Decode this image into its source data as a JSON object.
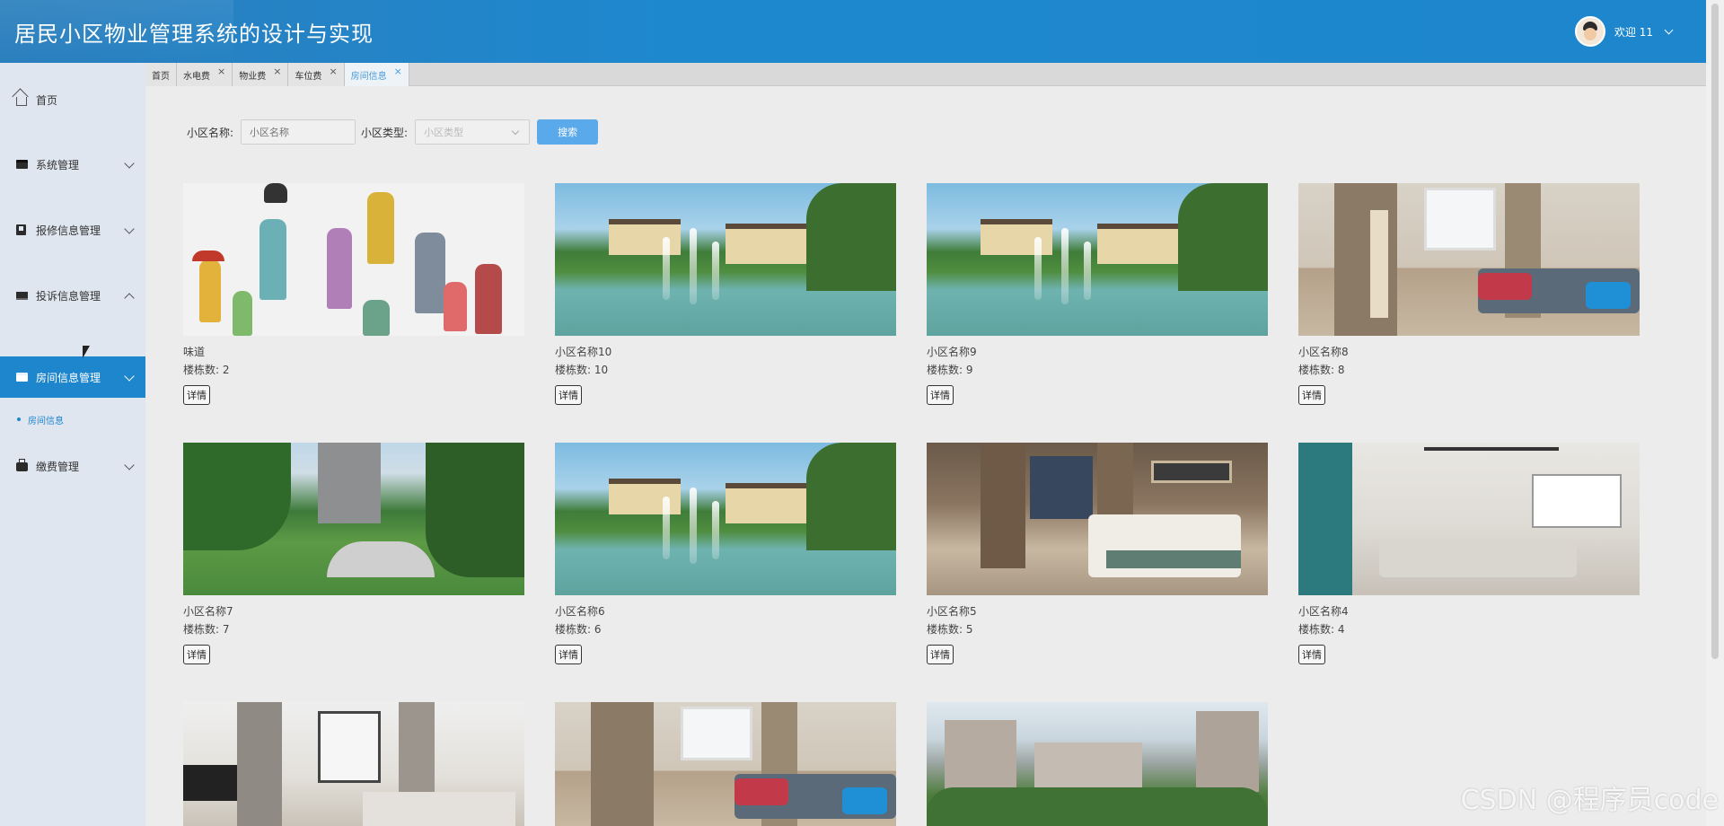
{
  "header": {
    "title": "居民小区物业管理系统的设计与实现",
    "welcome": "欢迎 11"
  },
  "sidebar": {
    "items": [
      {
        "label": "首页",
        "icon": "home-icon"
      },
      {
        "label": "系统管理",
        "icon": "box-icon"
      },
      {
        "label": "报修信息管理",
        "icon": "book-icon"
      },
      {
        "label": "投诉信息管理",
        "icon": "monitor-icon"
      },
      {
        "label": "房间信息管理",
        "icon": "box-icon"
      },
      {
        "label": "缴费管理",
        "icon": "bag-icon"
      }
    ],
    "sub_item": "房间信息"
  },
  "tabs": [
    {
      "label": "首页",
      "closable": false
    },
    {
      "label": "水电费",
      "closable": true
    },
    {
      "label": "物业费",
      "closable": true
    },
    {
      "label": "车位费",
      "closable": true
    },
    {
      "label": "房间信息",
      "closable": true
    }
  ],
  "search": {
    "name_label": "小区名称:",
    "name_placeholder": "小区名称",
    "type_label": "小区类型:",
    "type_placeholder": "小区类型",
    "button": "搜索"
  },
  "cards": [
    {
      "name": "味道",
      "count_label": "楼栋数:",
      "count": "2",
      "detail": "详情"
    },
    {
      "name": "小区名称10",
      "count_label": "楼栋数:",
      "count": "10",
      "detail": "详情"
    },
    {
      "name": "小区名称9",
      "count_label": "楼栋数:",
      "count": "9",
      "detail": "详情"
    },
    {
      "name": "小区名称8",
      "count_label": "楼栋数:",
      "count": "8",
      "detail": "详情"
    },
    {
      "name": "小区名称7",
      "count_label": "楼栋数:",
      "count": "7",
      "detail": "详情"
    },
    {
      "name": "小区名称6",
      "count_label": "楼栋数:",
      "count": "6",
      "detail": "详情"
    },
    {
      "name": "小区名称5",
      "count_label": "楼栋数:",
      "count": "5",
      "detail": "详情"
    },
    {
      "name": "小区名称4",
      "count_label": "楼栋数:",
      "count": "4",
      "detail": "详情"
    }
  ],
  "watermark": "CSDN @程序员code",
  "colors": {
    "header": "#1e88cf",
    "accent": "#1e86cc",
    "search_button": "#5aa9ea",
    "sidebar_bg": "#dfe6ef",
    "content_bg": "#ececec"
  }
}
